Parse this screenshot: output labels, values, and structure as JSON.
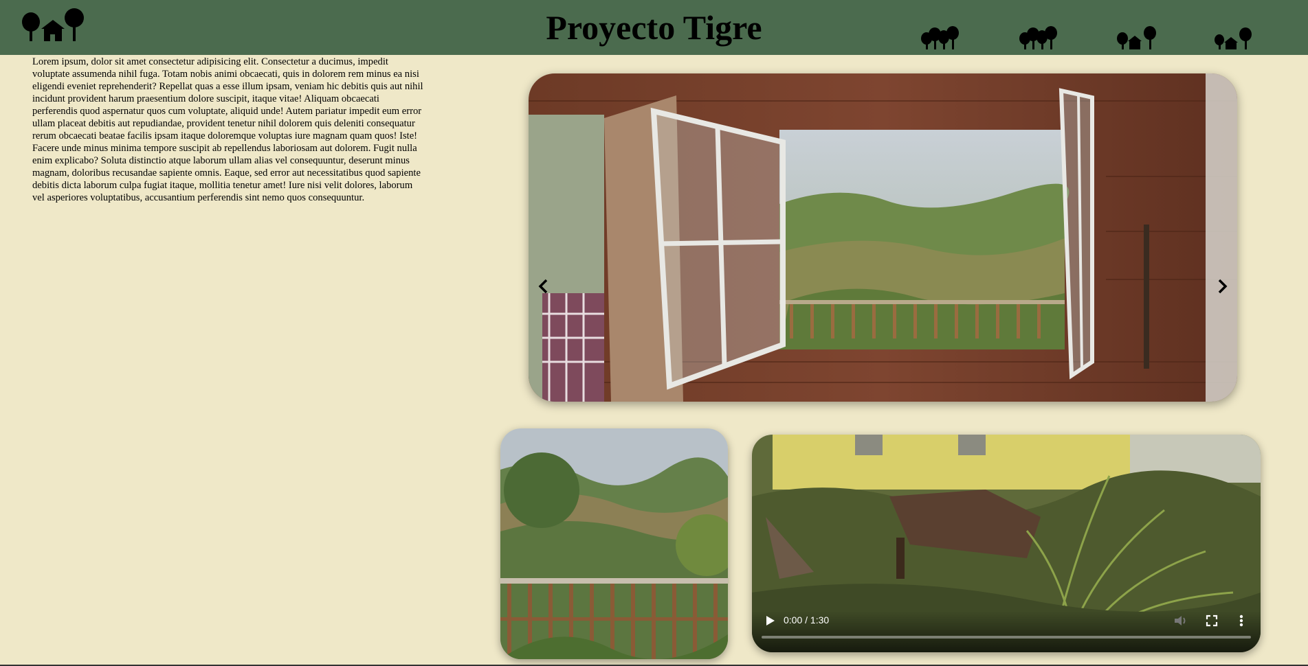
{
  "header": {
    "title": "Proyecto Tigre",
    "logo_icon": "trees-and-house-icon",
    "nav_icons": [
      "forest-icon",
      "forest-icon",
      "trees-and-house-icon",
      "trees-and-house-icon"
    ],
    "background_color": "#4b6b4e"
  },
  "intro": {
    "text": "Lorem ipsum, dolor sit amet consectetur adipisicing elit. Consectetur a ducimus, impedit voluptate assumenda nihil fuga. Totam nobis animi obcaecati, quis in dolorem rem minus ea nisi eligendi eveniet reprehenderit? Repellat quas a esse illum ipsam, veniam hic debitis quis aut nihil incidunt provident harum praesentium dolore suscipit, itaque vitae! Aliquam obcaecati perferendis quod aspernatur quos cum voluptate, aliquid unde! Autem pariatur impedit eum error ullam placeat debitis aut repudiandae, provident tenetur nihil dolorem quis deleniti consequatur rerum obcaecati beatae facilis ipsam itaque doloremque voluptas iure magnam quam quos! Iste! Facere unde minus minima tempore suscipit ab repellendus laboriosam aut dolorem. Fugit nulla enim explicabo? Soluta distinctio atque laborum ullam alias vel consequuntur, deserunt minus magnam, doloribus recusandae sapiente omnis. Eaque, sed error aut necessitatibus quod sapiente debitis dicta laborum culpa fugiat itaque, mollitia tenetur amet! Iure nisi velit dolores, laborum vel asperiores voluptatibus, accusantium perferendis sint nemo quos consequuntur."
  },
  "carousel": {
    "prev_icon": "chevron-left-icon",
    "next_icon": "chevron-right-icon"
  },
  "video": {
    "time": "0:00 / 1:30",
    "progress": 0,
    "play_icon": "play-icon",
    "mute_icon": "volume-icon",
    "fullscreen_icon": "fullscreen-icon",
    "more_icon": "more-vertical-icon"
  },
  "colors": {
    "page_background": "#efe8c8",
    "header": "#4b6b4e"
  }
}
